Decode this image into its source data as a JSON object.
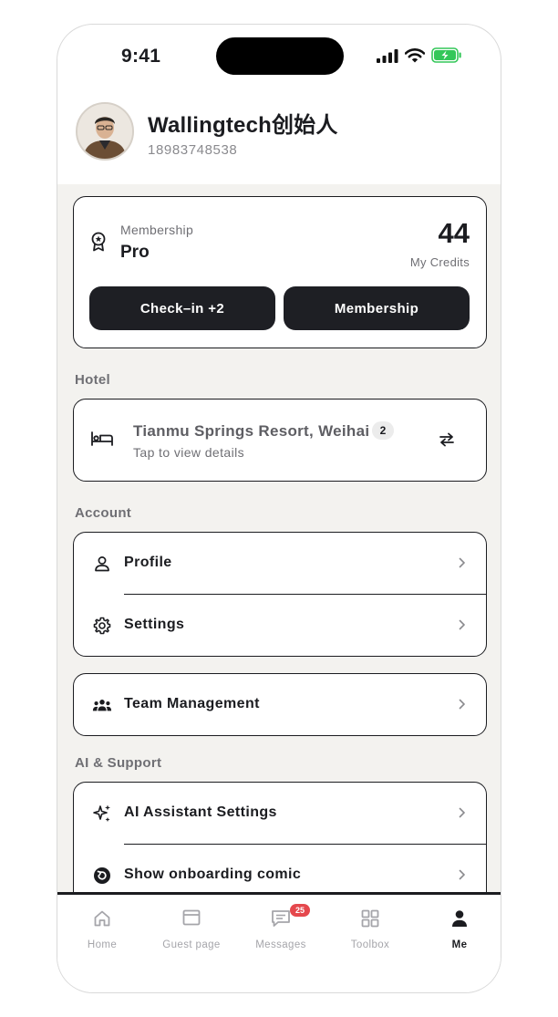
{
  "status_bar": {
    "time": "9:41"
  },
  "profile": {
    "name": "Wallingtech创始人",
    "phone": "18983748538"
  },
  "membership": {
    "label": "Membership",
    "tier": "Pro",
    "credits": "44",
    "credits_label": "My Credits",
    "checkin_label": "Check–in +2",
    "membership_button_label": "Membership"
  },
  "hotel": {
    "section_label": "Hotel",
    "name": "Tianmu Springs Resort, Weihai",
    "count": "2",
    "subtitle": "Tap to view details"
  },
  "account": {
    "section_label": "Account",
    "items": [
      {
        "label": "Profile",
        "icon": "person-icon"
      },
      {
        "label": "Settings",
        "icon": "gear-icon"
      }
    ]
  },
  "team": {
    "label": "Team Management",
    "icon": "team-icon"
  },
  "ai_support": {
    "section_label": "AI & Support",
    "items": [
      {
        "label": "AI Assistant Settings",
        "icon": "sparkles-icon"
      },
      {
        "label": "Show onboarding comic",
        "icon": "replay-icon"
      }
    ]
  },
  "tabbar": {
    "tabs": [
      {
        "label": "Home",
        "icon": "home-icon"
      },
      {
        "label": "Guest page",
        "icon": "window-icon"
      },
      {
        "label": "Messages",
        "icon": "message-icon",
        "badge": "25"
      },
      {
        "label": "Toolbox",
        "icon": "grid-icon"
      },
      {
        "label": "Me",
        "icon": "person-filled-icon",
        "active": true
      }
    ]
  },
  "colors": {
    "primary": "#1e1f24",
    "background": "#f3f2ef",
    "badge": "#e5484d",
    "battery": "#34c759"
  }
}
